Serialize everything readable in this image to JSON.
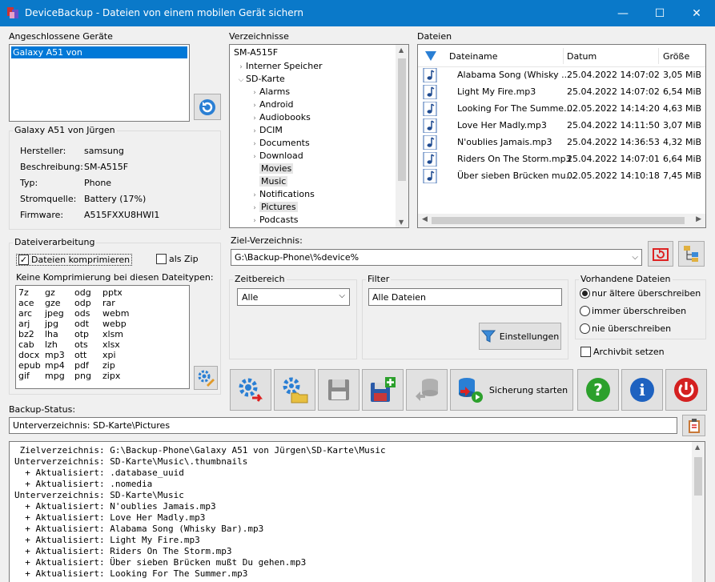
{
  "window": {
    "title": "DeviceBackup - Dateien von einem mobilen Gerät sichern",
    "min": "—",
    "max": "☐",
    "close": "✕"
  },
  "devices": {
    "label": "Angeschlossene Geräte",
    "items": [
      "Galaxy A51 von"
    ]
  },
  "device_info": {
    "title": "Galaxy A51 von Jürgen",
    "rows": [
      {
        "k": "Hersteller:",
        "v": "samsung"
      },
      {
        "k": "Beschreibung:",
        "v": "SM-A515F"
      },
      {
        "k": "Typ:",
        "v": "Phone"
      },
      {
        "k": "Stromquelle:",
        "v": "Battery (17%)"
      },
      {
        "k": "Firmware:",
        "v": "A515FXXU8HWI1"
      }
    ]
  },
  "tree": {
    "label": "Verzeichnisse",
    "root": "SM-A515F",
    "items": [
      {
        "label": "Interner Speicher",
        "state": "collapsed"
      },
      {
        "label": "SD-Karte",
        "state": "expanded"
      },
      {
        "label": "Alarms",
        "state": "collapsed"
      },
      {
        "label": "Android",
        "state": "collapsed"
      },
      {
        "label": "Audiobooks",
        "state": "collapsed"
      },
      {
        "label": "DCIM",
        "state": "collapsed"
      },
      {
        "label": "Documents",
        "state": "collapsed"
      },
      {
        "label": "Download",
        "state": "collapsed"
      },
      {
        "label": "Movies",
        "state": "none"
      },
      {
        "label": "Music",
        "state": "none"
      },
      {
        "label": "Notifications",
        "state": "collapsed"
      },
      {
        "label": "Pictures",
        "state": "collapsed"
      },
      {
        "label": "Podcasts",
        "state": "collapsed"
      }
    ]
  },
  "files": {
    "label": "Dateien",
    "columns": [
      "Dateiname",
      "Datum",
      "Größe"
    ],
    "rows": [
      {
        "name": "Alabama Song (Whisky ...",
        "date": "25.04.2022 14:07:02",
        "size": "3,05 MiB"
      },
      {
        "name": "Light My Fire.mp3",
        "date": "25.04.2022 14:07:02",
        "size": "6,54 MiB"
      },
      {
        "name": "Looking For The Summe...",
        "date": "02.05.2022 14:14:20",
        "size": "4,63 MiB"
      },
      {
        "name": "Love Her Madly.mp3",
        "date": "25.04.2022 14:11:50",
        "size": "3,07 MiB"
      },
      {
        "name": "N'oublies Jamais.mp3",
        "date": "25.04.2022 14:36:53",
        "size": "4,32 MiB"
      },
      {
        "name": "Riders On The Storm.mp3",
        "date": "25.04.2022 14:07:01",
        "size": "6,64 MiB"
      },
      {
        "name": "Über sieben Brücken mu...",
        "date": "02.05.2022 14:10:18",
        "size": "7,45 MiB"
      }
    ]
  },
  "processing": {
    "title": "Dateiverarbeitung",
    "compress": "Dateien komprimieren",
    "zip": "als Zip",
    "no_compress_label": "Keine Komprimierung bei diesen Dateitypen:",
    "types": [
      [
        "7z",
        "gz",
        "odg",
        "pptx"
      ],
      [
        "ace",
        "gze",
        "odp",
        "rar"
      ],
      [
        "arc",
        "jpeg",
        "ods",
        "webm"
      ],
      [
        "arj",
        "jpg",
        "odt",
        "webp"
      ],
      [
        "bz2",
        "lha",
        "otp",
        "xlsm"
      ],
      [
        "cab",
        "lzh",
        "ots",
        "xlsx"
      ],
      [
        "docx",
        "mp3",
        "ott",
        "xpi"
      ],
      [
        "epub",
        "mp4",
        "pdf",
        "zip"
      ],
      [
        "gif",
        "mpg",
        "png",
        "zipx"
      ]
    ]
  },
  "target": {
    "label": "Ziel-Verzeichnis:",
    "value": "G:\\Backup-Phone\\%device%"
  },
  "timerange": {
    "title": "Zeitbereich",
    "value": "Alle"
  },
  "filter": {
    "title": "Filter",
    "value": "Alle Dateien",
    "settings": "Einstellungen"
  },
  "existing": {
    "title": "Vorhandene Dateien",
    "options": [
      "nur ältere überschreiben",
      "immer überschreiben",
      "nie überschreiben"
    ],
    "archive": "Archivbit setzen"
  },
  "start_label": "Sicherung starten",
  "status": {
    "label": "Backup-Status:",
    "value": "Unterverzeichnis: SD-Karte\\Pictures"
  },
  "log": [
    " Zielverzeichnis: G:\\Backup-Phone\\Galaxy A51 von Jürgen\\SD-Karte\\Music",
    "Unterverzeichnis: SD-Karte\\Music\\.thumbnails",
    "  + Aktualisiert: .database_uuid",
    "  + Aktualisiert: .nomedia",
    "Unterverzeichnis: SD-Karte\\Music",
    "  + Aktualisiert: N'oublies Jamais.mp3",
    "  + Aktualisiert: Love Her Madly.mp3",
    "  + Aktualisiert: Alabama Song (Whisky Bar).mp3",
    "  + Aktualisiert: Light My Fire.mp3",
    "  + Aktualisiert: Riders On The Storm.mp3",
    "  + Aktualisiert: Über sieben Brücken mußt Du gehen.mp3",
    "  + Aktualisiert: Looking For The Summer.mp3"
  ],
  "colors": {
    "titlebar": "#0a79c9",
    "selection": "#0078d7",
    "accent": "#1e6fc0"
  }
}
